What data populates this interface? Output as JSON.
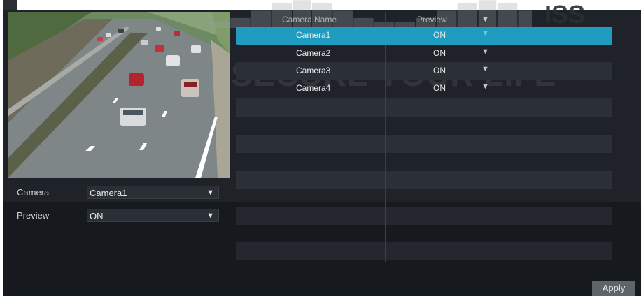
{
  "watermark": {
    "brand_text": "ISS",
    "slogan": "SECURE YOUR LIFE"
  },
  "form": {
    "camera_label": "Camera",
    "camera_value": "Camera1",
    "preview_label": "Preview",
    "preview_value": "ON"
  },
  "table": {
    "headers": [
      "Camera Name",
      "Preview"
    ],
    "rows": [
      {
        "name": "Camera1",
        "preview": "ON",
        "selected": true
      },
      {
        "name": "Camera2",
        "preview": "ON",
        "selected": false
      },
      {
        "name": "Camera3",
        "preview": "ON",
        "selected": false
      },
      {
        "name": "Camera4",
        "preview": "ON",
        "selected": false
      }
    ]
  },
  "buttons": {
    "apply_label": "Apply"
  },
  "colors": {
    "panel_bg": "#1f2329",
    "selected_row": "#1f9bbf",
    "apply_button": "#5f6468"
  }
}
